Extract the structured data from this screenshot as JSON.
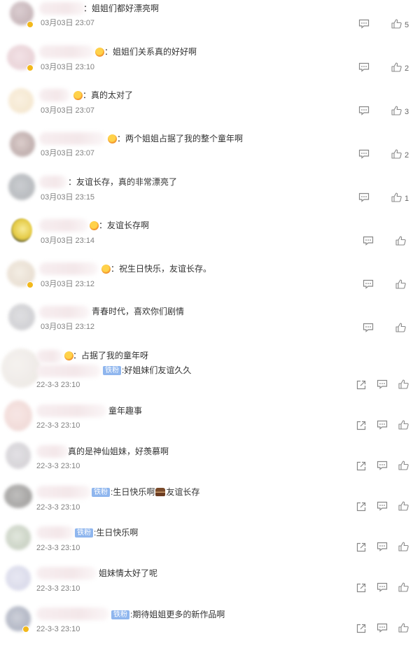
{
  "comments": [
    {
      "text": "：姐姐们都好漂亮啊",
      "time": "03月03日 23:07",
      "likes": "5"
    },
    {
      "text": "：姐姐们关系真的好好啊",
      "time": "03月03日 23:10",
      "likes": "2"
    },
    {
      "text": "：真的太对了",
      "time": "03月03日 23:07",
      "likes": "3"
    },
    {
      "text": "：两个姐姐占据了我的整个童年啊",
      "time": "03月03日 23:07",
      "likes": "2"
    },
    {
      "text": "：友谊长存，真的非常漂亮了",
      "time": "03月03日 23:15",
      "likes": "1"
    },
    {
      "text": "：友谊长存啊",
      "time": "03月03日 23:14",
      "likes": ""
    },
    {
      "text": "：祝生日快乐，友谊长存。",
      "time": "03月03日 23:12",
      "likes": ""
    },
    {
      "text": "青春时代，喜欢你们剧情",
      "time": "03月03日 23:12",
      "likes": ""
    }
  ],
  "reposts": [
    {
      "line1": "：占据了我的童年呀",
      "fan_badge": "铁粉",
      "text": ":好姐妹们友谊久久",
      "time": "22-3-3 23:10"
    },
    {
      "text": "童年趣事",
      "time": "22-3-3 23:10"
    },
    {
      "text": "真的是神仙姐妹，好羡慕啊",
      "time": "22-3-3 23:10"
    },
    {
      "fan_badge": "铁粉",
      "text": ":生日快乐啊",
      "text2": "友谊长存",
      "time": "22-3-3 23:10"
    },
    {
      "fan_badge": "铁粉",
      "text": ":生日快乐啊",
      "time": "22-3-3 23:10"
    },
    {
      "text": "姐妹情太好了呢",
      "time": "22-3-3 23:10"
    },
    {
      "fan_badge": "铁粉",
      "text": ":期待姐姐更多的新作品啊",
      "time": "22-3-3 23:10"
    }
  ],
  "colors": {
    "text": "#333333",
    "time": "#808080",
    "icon": "#888888",
    "fan_badge": "#8fb6ee"
  },
  "icons": [
    "comment-icon",
    "thumbs-up-icon",
    "share-icon"
  ]
}
